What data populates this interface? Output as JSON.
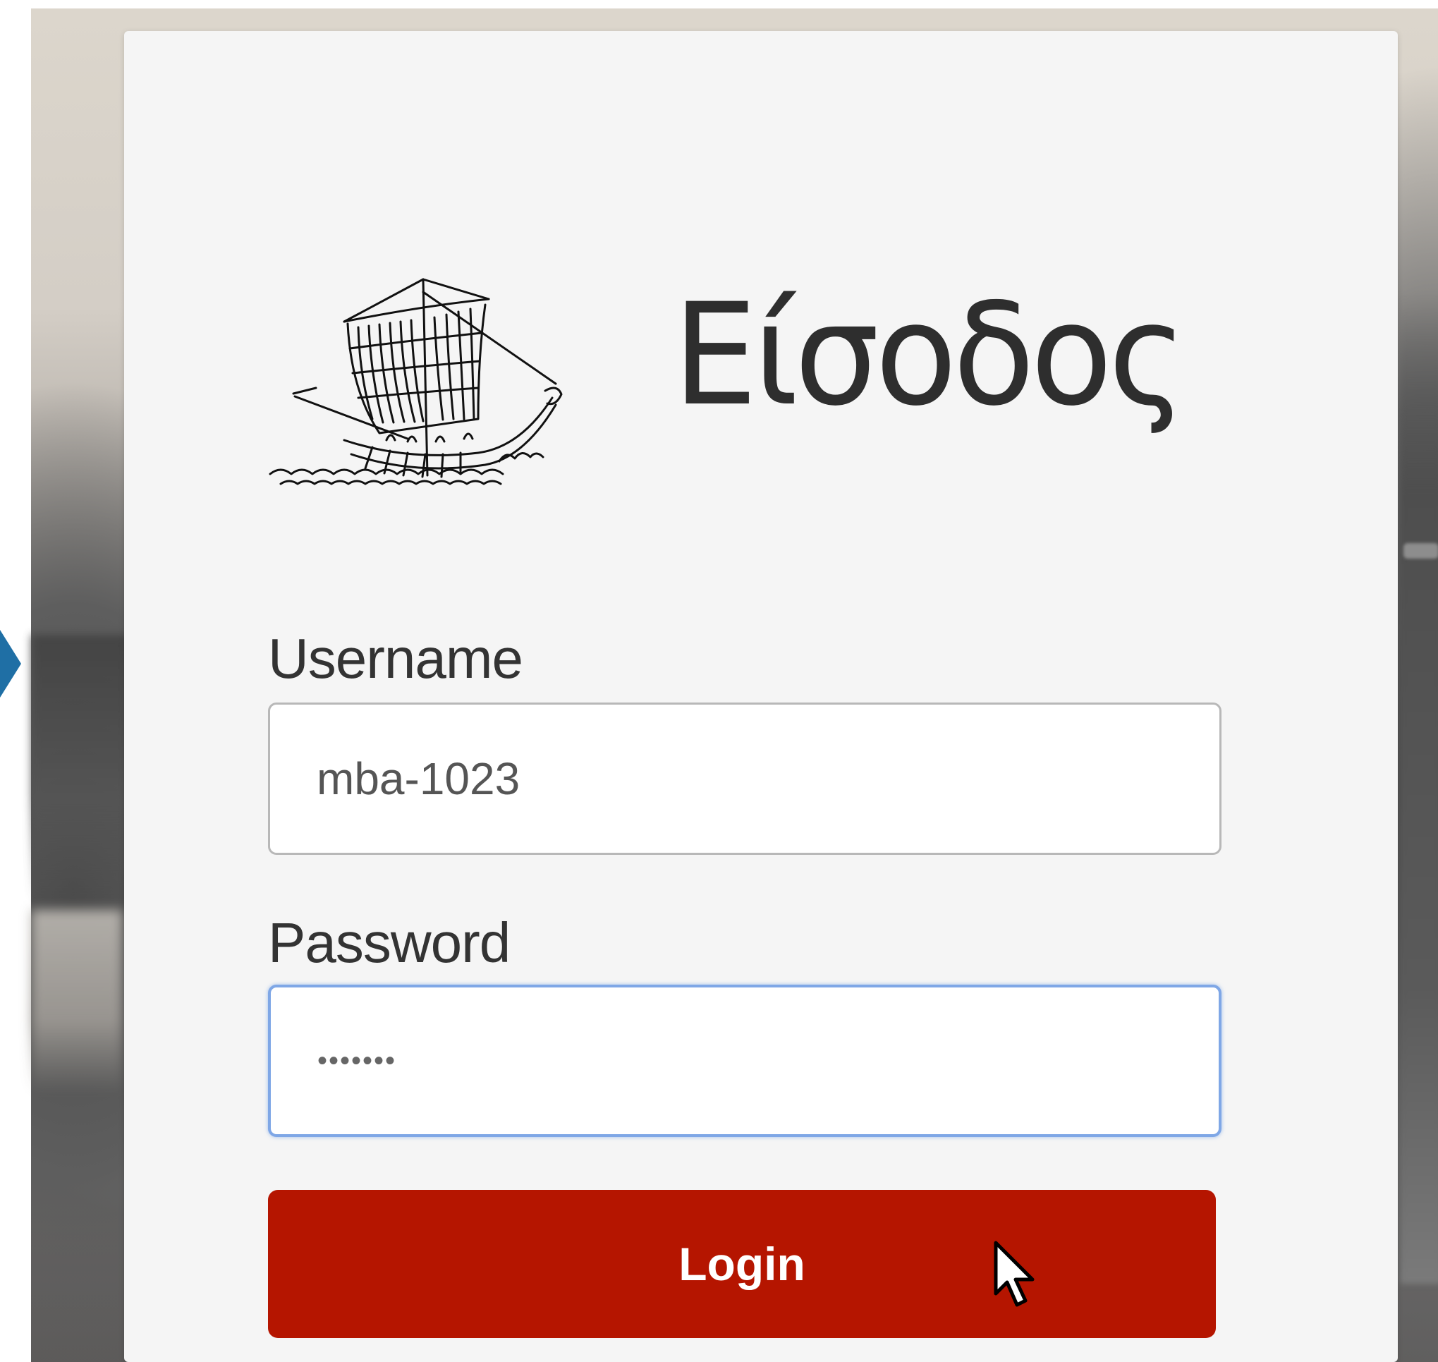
{
  "login_card": {
    "title": "Είσοδος",
    "logo": "ancient-ship-logo",
    "username_label": "Username",
    "username_value": "mba-1023",
    "password_label": "Password",
    "password_value": "•••••••",
    "login_label": "Login"
  },
  "colors": {
    "card_background": "#f5f5f5",
    "login_button": "#b51500",
    "focused_border": "#7fa7e6",
    "arrow_marker": "#1f6fa5"
  }
}
